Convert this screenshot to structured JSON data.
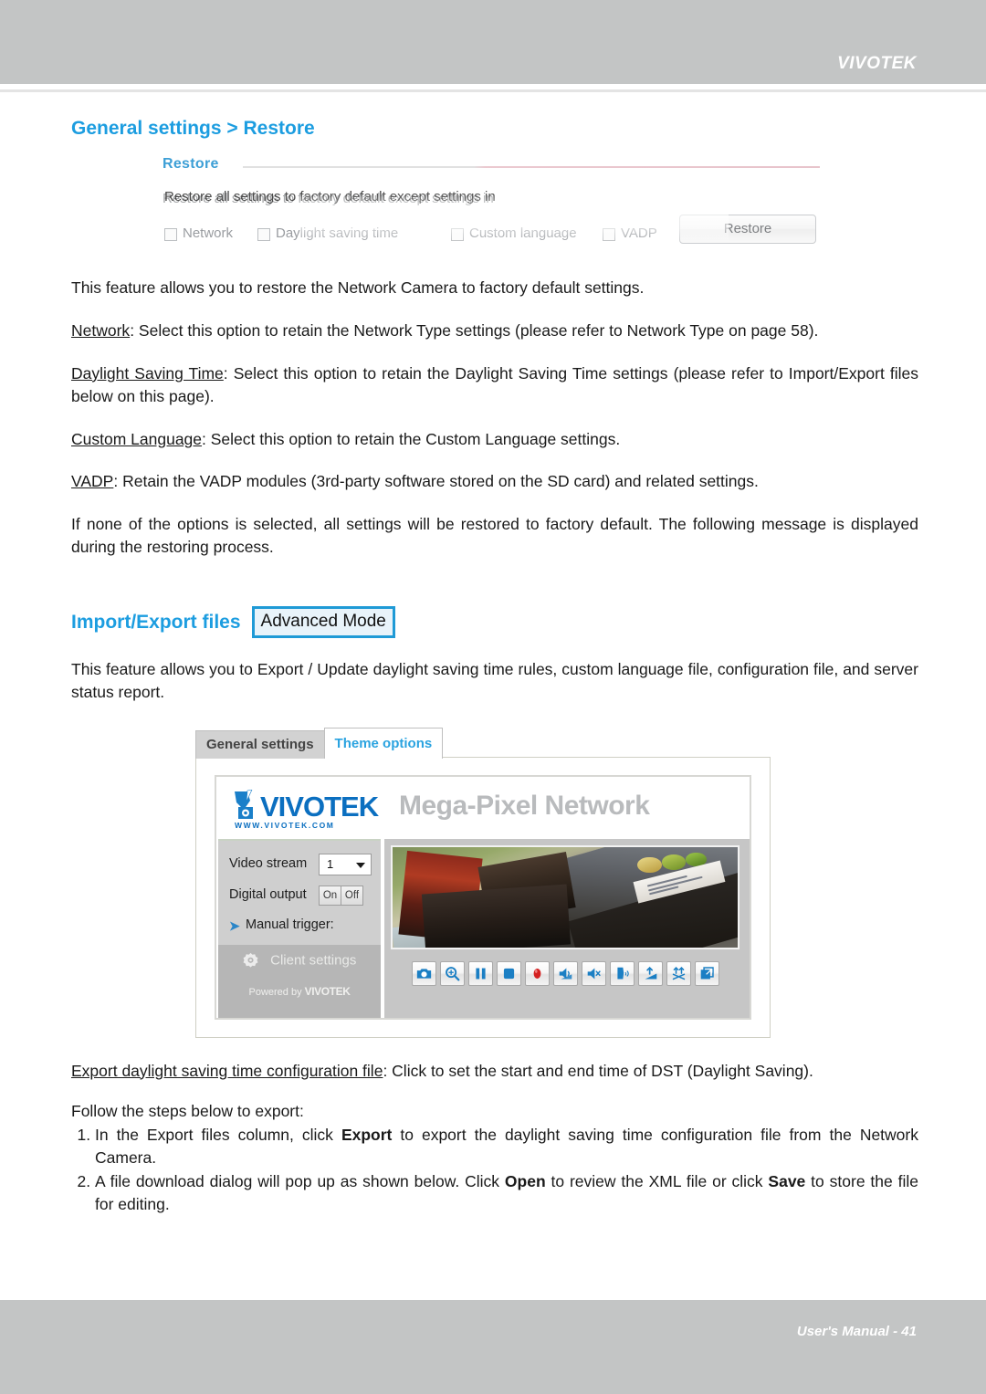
{
  "header": {
    "brand": "VIVOTEK"
  },
  "footer": {
    "text": "User's Manual - 41"
  },
  "restore_section": {
    "title": "General settings > Restore",
    "figure": {
      "panel_title": "Restore",
      "description": "Restore all settings to factory default except settings in",
      "options": [
        "Network",
        "Daylight saving time",
        "Custom language",
        "VADP"
      ],
      "button_label": "Restore"
    },
    "paragraphs": {
      "intro": "This feature allows you to restore the Network Camera to factory default settings.",
      "network_label": "Network",
      "network_body": ": Select this option to retain the Network Type settings (please refer to Network Type on page 58).",
      "dst_label": "Daylight Saving Time",
      "dst_body": ": Select this option to retain the Daylight Saving Time settings (please refer to Import/Export files below on this page).",
      "lang_label": "Custom Language",
      "lang_body": ": Select this option to retain the Custom Language settings.",
      "vadp_label": "VADP",
      "vadp_body": ": Retain the VADP modules (3rd-party software stored on the SD card) and related settings.",
      "none_selected": "If none of the options is selected, all settings will be restored to factory default.  The following message is displayed during the restoring process."
    }
  },
  "import_export_section": {
    "title": "Import/Export files",
    "badge": "Advanced Mode",
    "intro": "This feature allows you to Export / Update daylight saving time rules, custom language file, configuration file, and server status report.",
    "figure": {
      "tabs": [
        {
          "label": "General settings",
          "active": false
        },
        {
          "label": "Theme options",
          "active": true
        }
      ],
      "brand_name": "VIVOTEK",
      "brand_url": "WWW.VIVOTEK.COM",
      "page_title": "Mega-Pixel Network",
      "controls": {
        "video_stream_label": "Video stream",
        "video_stream_value": "1",
        "digital_output_label": "Digital output",
        "digital_output_on": "On",
        "digital_output_off": "Off",
        "manual_trigger_label": "Manual trigger:",
        "client_settings_label": "Client settings",
        "powered_by_label": "Powered by",
        "powered_by_brand": "VIVOTEK"
      },
      "toolbar_icons": [
        "snapshot-icon",
        "digital-zoom-icon",
        "pause-icon",
        "stop-icon",
        "record-icon",
        "volume-icon",
        "mute-icon",
        "microphone-icon",
        "mic-volume-icon",
        "talk-icon",
        "fullscreen-icon"
      ]
    },
    "export_label": "Export daylight saving time configuration file",
    "export_body": ": Click to set the start and end time of DST (Daylight Saving).",
    "follow_steps": "Follow the steps below to export:",
    "steps": [
      {
        "pre": "In the Export files column, click ",
        "bold": "Export",
        "post": " to export the daylight saving time configuration file from the Network Camera."
      },
      {
        "pre": "A file download dialog will pop up as shown below. Click ",
        "bold": "Open",
        "mid": " to review the XML file or click ",
        "bold2": "Save",
        "post": " to store the file for editing."
      }
    ]
  },
  "colors": {
    "heading_blue": "#1c9de0",
    "header_gray": "#c3c5c5",
    "badge_border": "#1f9ad6",
    "vivotek_blue": "#0b6fc0",
    "tab_active_text": "#2aa3e0"
  }
}
